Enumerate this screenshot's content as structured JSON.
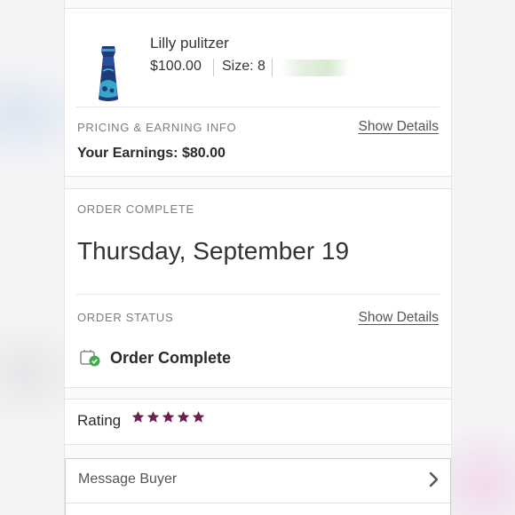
{
  "product": {
    "title": "Lilly pulitzer",
    "price": "$100.00",
    "size": "Size: 8"
  },
  "pricing": {
    "header": "PRICING & EARNING INFO",
    "show_details": "Show Details",
    "earnings": "Your Earnings: $80.00"
  },
  "order": {
    "complete_header": "ORDER COMPLETE",
    "date": "Thursday, September 19",
    "status_header": "ORDER STATUS",
    "show_details": "Show Details",
    "status_text": "Order Complete"
  },
  "rating": {
    "label": "Rating",
    "stars": 5,
    "star_color": "#6b1f4f"
  },
  "message": {
    "label": "Message Buyer"
  },
  "colors": {
    "status_check": "#3fae49",
    "divider": "#e6e6e6",
    "muted_text": "#7d7d7d"
  }
}
